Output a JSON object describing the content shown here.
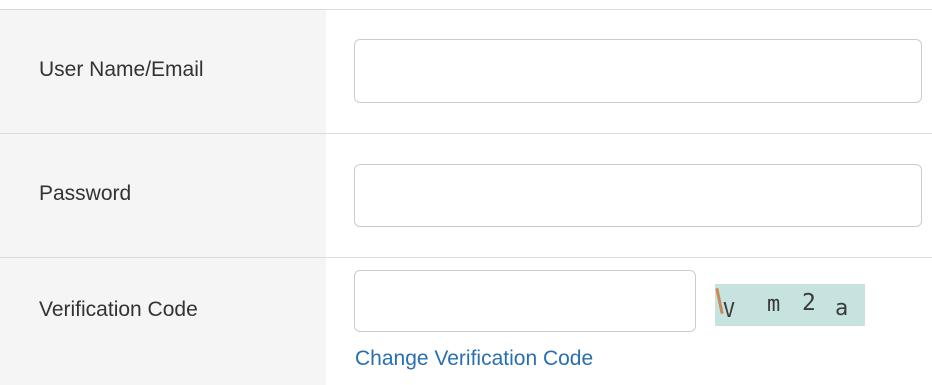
{
  "form": {
    "username": {
      "label": "User Name/Email",
      "value": "",
      "placeholder": ""
    },
    "password": {
      "label": "Password",
      "value": "",
      "placeholder": ""
    },
    "verification": {
      "label": "Verification Code",
      "value": "",
      "placeholder": "",
      "captcha_text": "Vm2a",
      "change_link": "Change Verification Code"
    }
  },
  "colors": {
    "label_background": "#f5f5f5",
    "border": "#cccccc",
    "link": "#2a6fb0",
    "captcha_background": "#c6e3e0"
  },
  "icons": {
    "captcha": "captcha-image"
  }
}
